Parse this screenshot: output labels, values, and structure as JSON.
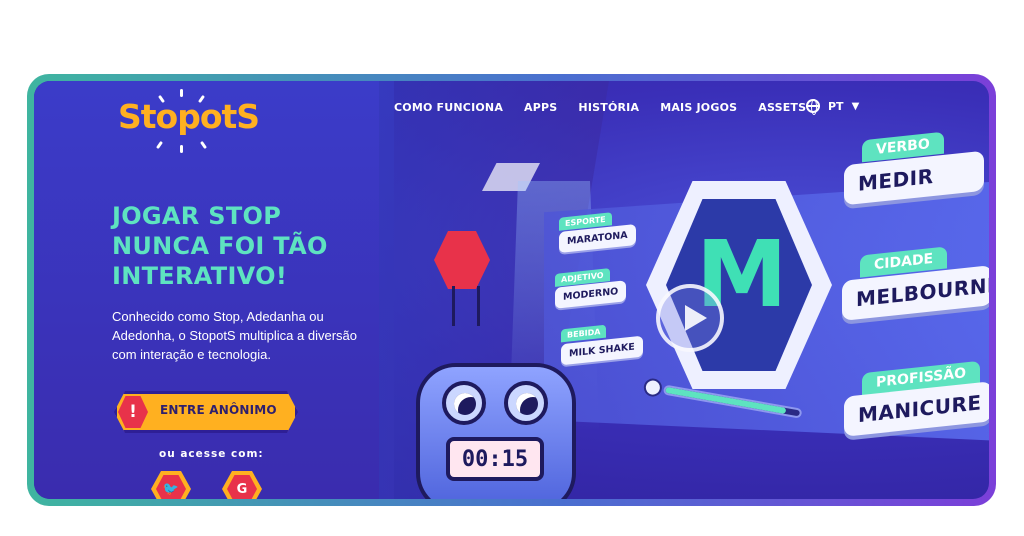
{
  "brand": {
    "logo_text": "StopotS",
    "accent": "#ffb020",
    "primary_bg": "#3a2fb8",
    "highlight": "#5ee3c0"
  },
  "nav": {
    "items": [
      "COMO FUNCIONA",
      "APPS",
      "HISTÓRIA",
      "MAIS JOGOS",
      "ASSETS"
    ],
    "language": "PT"
  },
  "hero": {
    "headline": [
      "JOGAR STOP",
      "NUNCA FOI TÃO",
      "INTERATIVO!"
    ],
    "description": "Conhecido como Stop, Adedanha ou Adedonha, o StopotS multiplica a diversão com interação e tecnologia.",
    "cta_label": "ENTRE ANÔNIMO",
    "cta_icon": "!",
    "alt_login_label": "ou acesse com:",
    "social": [
      {
        "name": "twitter-icon",
        "glyph": "🐦"
      },
      {
        "name": "google-icon",
        "glyph": "G"
      }
    ]
  },
  "illustration": {
    "letter": "M",
    "timer": "00:15",
    "progress_fraction": 0.9,
    "small_tags": [
      {
        "category": "ESPORTE",
        "word": "MARATONA"
      },
      {
        "category": "ADJETIVO",
        "word": "MODERNO"
      },
      {
        "category": "BEBIDA",
        "word": "MILK SHAKE"
      }
    ],
    "big_tags": [
      {
        "category": "VERBO",
        "word": "MEDIR"
      },
      {
        "category": "CIDADE",
        "word": "MELBOURNE"
      },
      {
        "category": "PROFISSÃO",
        "word": "MANICURE"
      }
    ]
  }
}
